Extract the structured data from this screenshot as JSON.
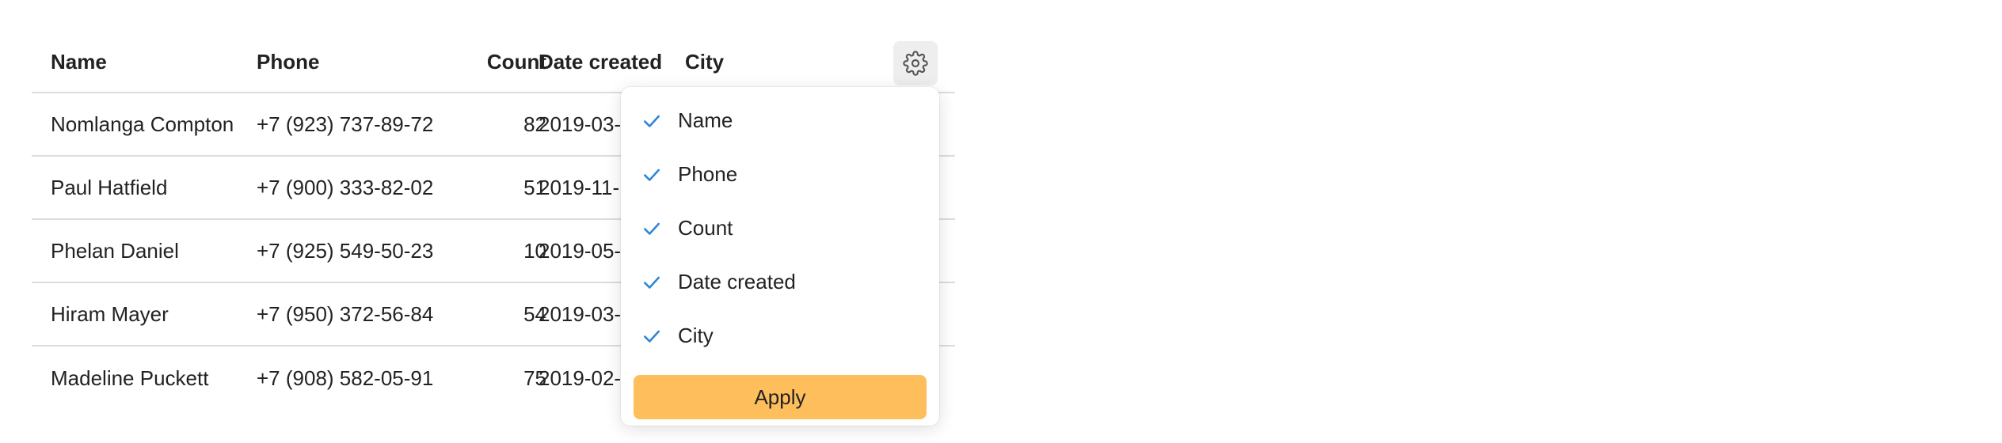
{
  "table": {
    "columns": {
      "name": "Name",
      "phone": "Phone",
      "count": "Count",
      "date": "Date created",
      "city": "City"
    },
    "rows": [
      {
        "name": "Nomlanga Compton",
        "phone": "+7 (923) 737-89-72",
        "count": "82",
        "date": "2019-03-"
      },
      {
        "name": "Paul Hatfield",
        "phone": "+7 (900) 333-82-02",
        "count": "51",
        "date": "2019-11-"
      },
      {
        "name": "Phelan Daniel",
        "phone": "+7 (925) 549-50-23",
        "count": "10",
        "date": "2019-05-"
      },
      {
        "name": "Hiram Mayer",
        "phone": "+7 (950) 372-56-84",
        "count": "54",
        "date": "2019-03-"
      },
      {
        "name": "Madeline Puckett",
        "phone": "+7 (908) 582-05-91",
        "count": "75",
        "date": "2019-02-"
      }
    ]
  },
  "settings_button": {
    "icon": "gear-icon"
  },
  "column_menu": {
    "items": [
      {
        "label": "Name",
        "checked": true
      },
      {
        "label": "Phone",
        "checked": true
      },
      {
        "label": "Count",
        "checked": true
      },
      {
        "label": "Date created",
        "checked": true
      },
      {
        "label": "City",
        "checked": true
      }
    ],
    "apply_label": "Apply"
  },
  "colors": {
    "check": "#2f86d8",
    "apply_bg": "#ffbe5c",
    "row_divider": "#dcdcdc",
    "gear_bg": "#eeeeee"
  }
}
